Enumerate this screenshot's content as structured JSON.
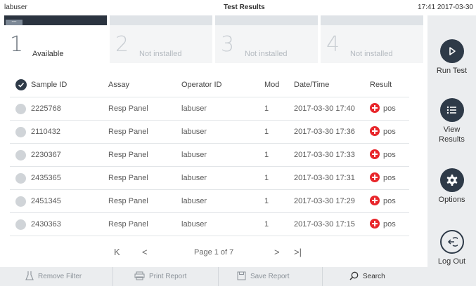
{
  "topbar": {
    "user": "labuser",
    "title": "Test Results",
    "clock": "17:41 2017-03-30"
  },
  "modules": [
    {
      "number": "1",
      "label": "Available",
      "chip": "---",
      "active": true
    },
    {
      "number": "2",
      "label": "Not installed"
    },
    {
      "number": "3",
      "label": "Not installed"
    },
    {
      "number": "4",
      "label": "Not installed"
    }
  ],
  "sidebar": {
    "run_test": "Run Test",
    "view_results": "View Results",
    "options": "Options",
    "log_out": "Log Out"
  },
  "table": {
    "columns": [
      "Sample ID",
      "Assay",
      "Operator ID",
      "Mod",
      "Date/Time",
      "Result"
    ],
    "rows": [
      {
        "sample_id": "2225768",
        "assay": "Resp Panel",
        "operator": "labuser",
        "mod": "1",
        "datetime": "2017-03-30 17:40",
        "result": "pos"
      },
      {
        "sample_id": "2110432",
        "assay": "Resp Panel",
        "operator": "labuser",
        "mod": "1",
        "datetime": "2017-03-30 17:36",
        "result": "pos"
      },
      {
        "sample_id": "2230367",
        "assay": "Resp Panel",
        "operator": "labuser",
        "mod": "1",
        "datetime": "2017-03-30 17:33",
        "result": "pos"
      },
      {
        "sample_id": "2435365",
        "assay": "Resp Panel",
        "operator": "labuser",
        "mod": "1",
        "datetime": "2017-03-30 17:31",
        "result": "pos"
      },
      {
        "sample_id": "2451345",
        "assay": "Resp Panel",
        "operator": "labuser",
        "mod": "1",
        "datetime": "2017-03-30 17:29",
        "result": "pos"
      },
      {
        "sample_id": "2430363",
        "assay": "Resp Panel",
        "operator": "labuser",
        "mod": "1",
        "datetime": "2017-03-30 17:15",
        "result": "pos"
      }
    ]
  },
  "pager": {
    "first": "K",
    "prev": "<",
    "label": "Page 1 of 7",
    "next": ">",
    "last": ">|"
  },
  "toolbar": {
    "remove_filter": "Remove Filter",
    "print_report": "Print Report",
    "save_report": "Save Report",
    "search": "Search"
  },
  "colors": {
    "dark": "#2e3a48",
    "positive": "#e8262b",
    "panel": "#ebedef"
  },
  "icons": {
    "run_test": "play-icon",
    "view_results": "list-icon",
    "options": "gear-icon",
    "log_out": "logout-icon",
    "remove_filter": "flask-icon",
    "print_report": "printer-icon",
    "save_report": "save-icon",
    "search": "search-icon"
  }
}
